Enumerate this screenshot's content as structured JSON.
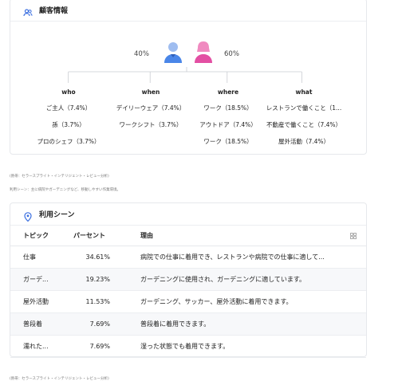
{
  "customer": {
    "title": "顧客情報",
    "female_pct": "40%",
    "male_pct": "60%",
    "columns": [
      {
        "heading": "who",
        "items": [
          "ご主人（7.4%）",
          "孫（3.7%）",
          "プロのシェフ（3.7%）"
        ]
      },
      {
        "heading": "when",
        "items": [
          "デイリーウェア（7.4%）",
          "ワークシフト（3.7%）"
        ]
      },
      {
        "heading": "where",
        "items": [
          "ワーク（18.5%）",
          "アウトドア（7.4%）",
          "ワーク（18.5%）"
        ]
      },
      {
        "heading": "what",
        "items": [
          "レストランで働くこと（1...",
          "不動産で働くこと（7.4%）",
          "屋外活動（7.4%）"
        ]
      }
    ]
  },
  "notes": {
    "source1": "(熱帯：セラースプライト・インテリジェント・レビュー分析)",
    "usage_desc": "利用シーン：主に病院やガーデニングなど、移動しやすい作業環境。",
    "source2": "(熱帯：セラースプライト・インテリジェント・レビュー分析)"
  },
  "scenes": {
    "title": "利用シーン",
    "headers": {
      "topic": "トピック",
      "percent": "パーセント",
      "reason": "理由"
    },
    "rows": [
      {
        "topic": "仕事",
        "percent": "34.61%",
        "reason": "病院での仕事に着用でき、レストランや病院での仕事に適して..."
      },
      {
        "topic": "ガーデ...",
        "percent": "19.23%",
        "reason": "ガーデニングに使用され、ガーデニングに適しています。"
      },
      {
        "topic": "屋外活動",
        "percent": "11.53%",
        "reason": "ガーデニング、サッカー、屋外活動に着用できます。"
      },
      {
        "topic": "普段着",
        "percent": "7.69%",
        "reason": "普段着に着用できます。"
      },
      {
        "topic": "濡れた...",
        "percent": "7.69%",
        "reason": "湿った状態でも着用できます。"
      }
    ]
  },
  "colors": {
    "accent": "#3b6fe0",
    "male": "#4a86e8",
    "female": "#e34fa3"
  }
}
